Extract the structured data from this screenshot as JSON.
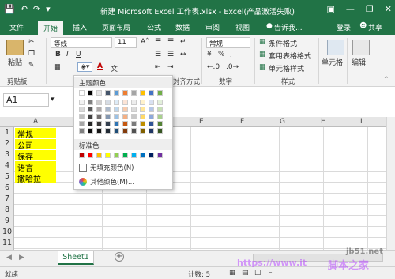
{
  "window": {
    "title": "新建 Microsoft Excel 工作表.xlsx - Excel(产品激活失败)",
    "qat_icons": [
      "save-icon",
      "undo-icon",
      "redo-icon",
      "customize-qat-icon"
    ]
  },
  "menu": {
    "tabs": [
      "文件",
      "开始",
      "插入",
      "页面布局",
      "公式",
      "数据",
      "审阅",
      "视图"
    ],
    "active_tab": "开始",
    "tell_me": "告诉我...",
    "login": "登录",
    "share": "共享"
  },
  "ribbon": {
    "paste_label": "粘贴",
    "clipboard_label": "剪贴板",
    "font_name": "等线",
    "font_size": "11",
    "bold": "B",
    "italic": "I",
    "underline": "U",
    "font_color_letter": "A",
    "wen": "文",
    "align_label": "对齐方式",
    "number_format": "常规",
    "percent": "%",
    "comma": ",",
    "number_label": "数字",
    "cond_format": "条件格式",
    "table_format": "套用表格格式",
    "cell_style": "单元格样式",
    "styles_label": "样式",
    "cells_label": "单元格",
    "edit_label": "编辑"
  },
  "formula_bar": {
    "name_box": "A1",
    "fx": "fx"
  },
  "columns": [
    "A",
    "B",
    "C",
    "D",
    "E",
    "F",
    "G",
    "H",
    "I"
  ],
  "rows": [
    "1",
    "2",
    "3",
    "4",
    "5",
    "6",
    "7",
    "8",
    "9",
    "10",
    "11"
  ],
  "cells": [
    "常规",
    "公司",
    "保存",
    "语言",
    "撒哈拉"
  ],
  "sheet": {
    "tab": "Sheet1",
    "add": "+"
  },
  "status": {
    "left": "就绪",
    "count": "计数: 5"
  },
  "color_dropdown": {
    "theme_label": "主题颜色",
    "standard_label": "标准色",
    "no_fill": "无填充颜色(N)",
    "more_colors": "其他颜色(M)...",
    "theme_base": [
      "#ffffff",
      "#000000",
      "#e7e6e6",
      "#44546a",
      "#5b9bd5",
      "#ed7d31",
      "#a5a5a5",
      "#ffc000",
      "#4472c4",
      "#70ad47"
    ],
    "theme_shades": [
      [
        "#f2f2f2",
        "#808080",
        "#d0cece",
        "#d6dce4",
        "#ddebf7",
        "#fce4d6",
        "#ededed",
        "#fff2cc",
        "#d9e1f2",
        "#e2efda"
      ],
      [
        "#d9d9d9",
        "#595959",
        "#aeaaaa",
        "#acb9ca",
        "#bdd7ee",
        "#f8cbad",
        "#dbdbdb",
        "#ffe699",
        "#b4c6e7",
        "#c6e0b4"
      ],
      [
        "#bfbfbf",
        "#404040",
        "#757171",
        "#8497b0",
        "#9bc2e6",
        "#f4b084",
        "#c9c9c9",
        "#ffd966",
        "#8ea9db",
        "#a9d08e"
      ],
      [
        "#a6a6a6",
        "#262626",
        "#3a3838",
        "#333f4f",
        "#2f75b5",
        "#c65911",
        "#7b7b7b",
        "#bf8f00",
        "#305496",
        "#548235"
      ],
      [
        "#808080",
        "#0d0d0d",
        "#161616",
        "#222b35",
        "#1f4e78",
        "#833c0c",
        "#525252",
        "#806000",
        "#203764",
        "#375623"
      ]
    ],
    "standard": [
      "#c00000",
      "#ff0000",
      "#ffc000",
      "#ffff00",
      "#92d050",
      "#00b050",
      "#00b0f0",
      "#0070c0",
      "#002060",
      "#7030a0"
    ]
  },
  "watermark": {
    "line1": "jb51.net",
    "line2": "脚本之家",
    "line3": "https://www.it"
  }
}
